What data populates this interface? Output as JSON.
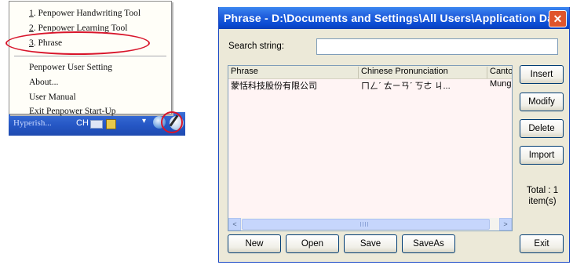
{
  "context_menu": {
    "items": [
      {
        "num": "1",
        "label": ". Penpower Handwriting Tool"
      },
      {
        "num": "2",
        "label": ". Penpower Learning Tool"
      },
      {
        "num": "3",
        "label": ". Phrase"
      },
      {
        "num": "",
        "label": "Penpower User Setting"
      },
      {
        "num": "",
        "label": "About..."
      },
      {
        "num": "",
        "label": "User Manual"
      },
      {
        "num": "",
        "label": "Exit Penpower Start-Up"
      }
    ]
  },
  "taskbar": {
    "left_text": "Hyperish...",
    "lang": "CH"
  },
  "window": {
    "title": "Phrase - D:\\Documents and Settings\\All Users\\Application Dat...",
    "close_glyph": "✕",
    "search_label": "Search string:",
    "search_value": "",
    "columns": [
      "Phrase",
      "Chinese Pronunciation",
      "Canto"
    ],
    "rows": [
      {
        "phrase": "蒙恬科技股份有限公司",
        "pron": "ㄇㄥˊ ㄊㄧㄢˊ ㄎㄜ ㄐ...",
        "canto": "Mung"
      }
    ],
    "side_buttons": [
      "Insert",
      "Modify",
      "Delete",
      "Import"
    ],
    "total_line1": "Total :   1",
    "total_line2": "item(s)",
    "bottom_buttons": [
      "New",
      "Open",
      "Save",
      "SaveAs"
    ],
    "exit_label": "Exit",
    "scroll_left": "<",
    "scroll_right": ">",
    "colors": {
      "titlebar": "#0a4ad2",
      "highlight": "#d8152b",
      "face": "#ece9d8"
    }
  }
}
